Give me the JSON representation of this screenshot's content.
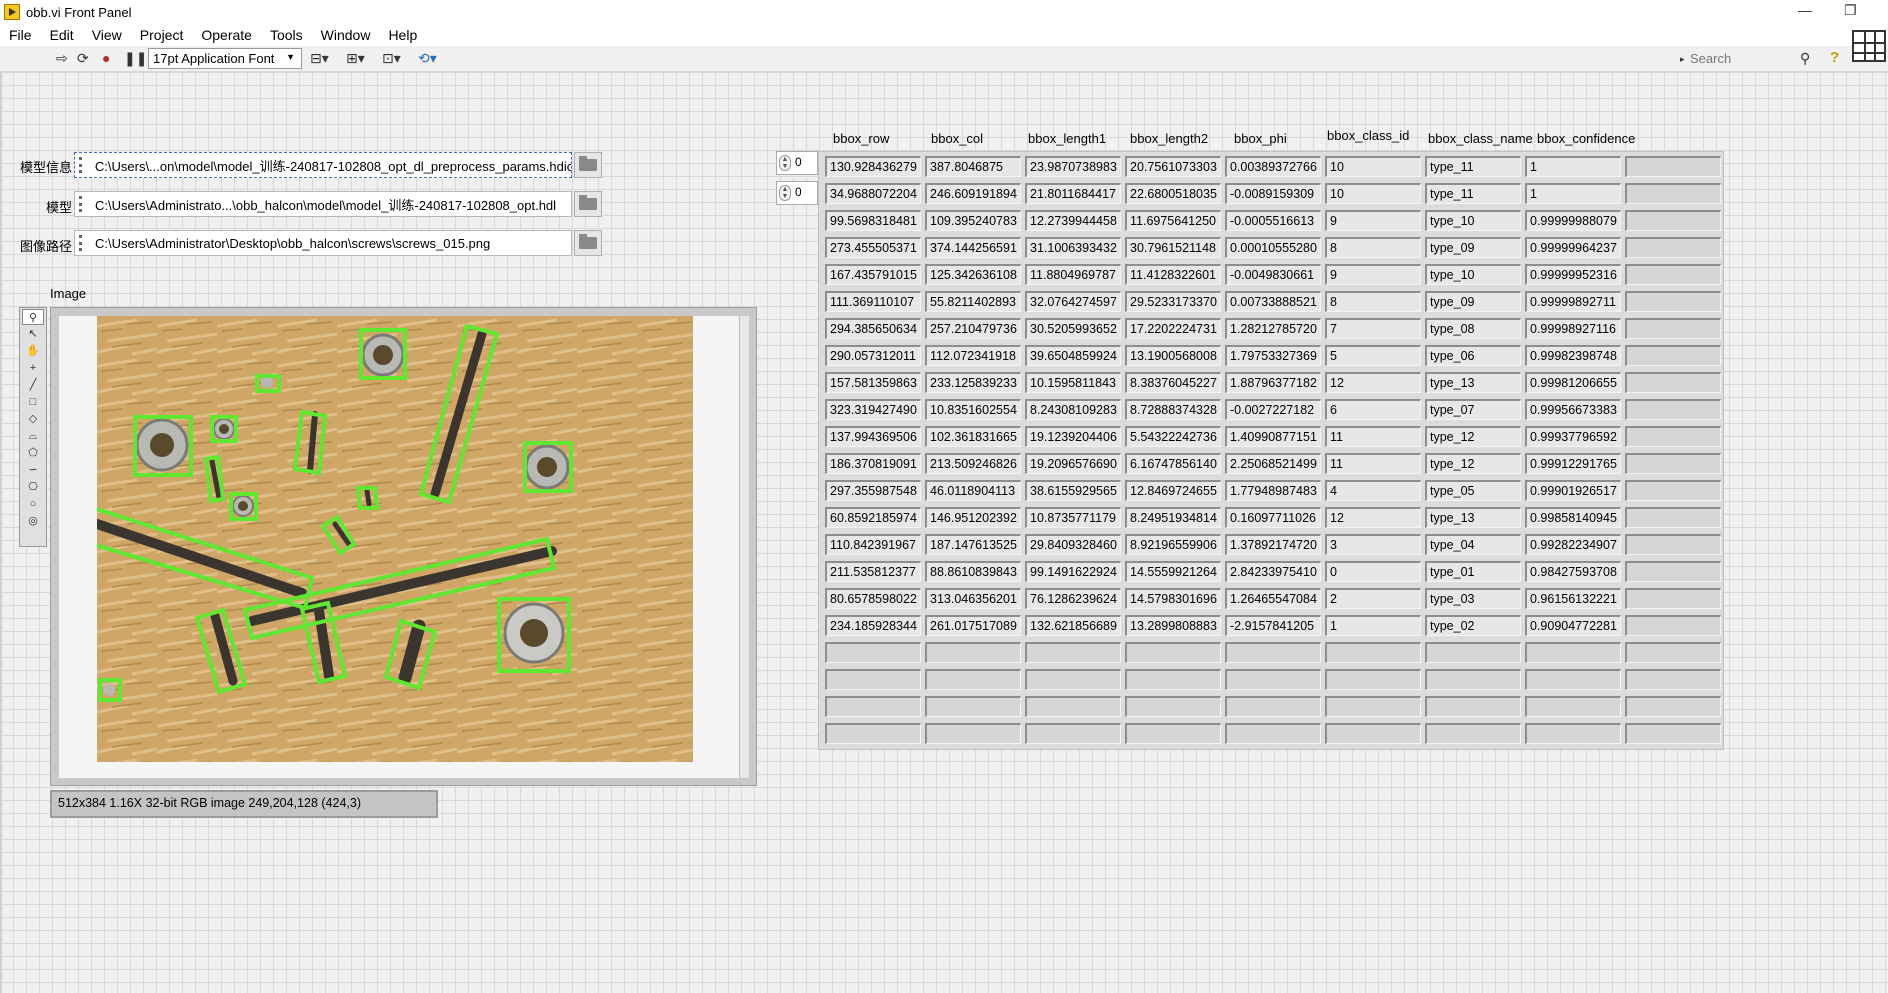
{
  "window": {
    "title": "obb.vi Front Panel"
  },
  "menu": [
    "File",
    "Edit",
    "View",
    "Project",
    "Operate",
    "Tools",
    "Window",
    "Help"
  ],
  "toolbar": {
    "font": "17pt Application Font",
    "search_placeholder": "Search"
  },
  "paths": [
    {
      "label": "模型信息",
      "value": "C:\\Users\\...on\\model\\model_训练-240817-102808_opt_dl_preprocess_params.hdict"
    },
    {
      "label": "模型",
      "value": "C:\\Users\\Administrato...\\obb_halcon\\model\\model_训练-240817-102808_opt.hdl"
    },
    {
      "label": "图像路径",
      "value": "C:\\Users\\Administrator\\Desktop\\obb_halcon\\screws\\screws_015.png"
    }
  ],
  "image_display": {
    "label": "Image",
    "info": "512x384 1.16X 32-bit RGB image 249,204,128     (424,3)"
  },
  "table": {
    "headers": [
      "bbox_row",
      "bbox_col",
      "bbox_length1",
      "bbox_length2",
      "bbox_phi",
      "bbox_class_id",
      "bbox_class_name",
      "bbox_confidence"
    ],
    "row_index": "0",
    "col_index": "0",
    "rows": [
      [
        "130.928436279",
        "387.8046875",
        "23.9870738983",
        "20.7561073303",
        "0.00389372766",
        "10",
        "type_11",
        "1"
      ],
      [
        "34.9688072204",
        "246.609191894",
        "21.8011684417",
        "22.6800518035",
        "-0.0089159309",
        "10",
        "type_11",
        "1"
      ],
      [
        "99.5698318481",
        "109.395240783",
        "12.2739944458",
        "11.6975641250",
        "-0.0005516613",
        "9",
        "type_10",
        "0.99999988079"
      ],
      [
        "273.455505371",
        "374.144256591",
        "31.1006393432",
        "30.7961521148",
        "0.00010555280",
        "8",
        "type_09",
        "0.99999964237"
      ],
      [
        "167.435791015",
        "125.342636108",
        "11.8804969787",
        "11.4128322601",
        "-0.0049830661",
        "9",
        "type_10",
        "0.99999952316"
      ],
      [
        "111.369110107",
        "55.8211402893",
        "32.0764274597",
        "29.5233173370",
        "0.00733888521",
        "8",
        "type_09",
        "0.99999892711"
      ],
      [
        "294.385650634",
        "257.210479736",
        "30.5205993652",
        "17.2202224731",
        "1.28212785720",
        "7",
        "type_08",
        "0.99998927116"
      ],
      [
        "290.057312011",
        "112.072341918",
        "39.6504859924",
        "13.1900568008",
        "1.79753327369",
        "5",
        "type_06",
        "0.99982398748"
      ],
      [
        "157.581359863",
        "233.125839233",
        "10.1595811843",
        "8.38376045227",
        "1.88796377182",
        "12",
        "type_13",
        "0.99981206655"
      ],
      [
        "323.319427490",
        "10.8351602554",
        "8.24308109283",
        "8.72888374328",
        "-0.0027227182",
        "6",
        "type_07",
        "0.99956673383"
      ],
      [
        "137.994369506",
        "102.361831665",
        "19.1239204406",
        "5.54322242736",
        "1.40990877151",
        "11",
        "type_12",
        "0.99937796592"
      ],
      [
        "186.370819091",
        "213.509246826",
        "19.2096576690",
        "6.16747856140",
        "2.25068521499",
        "11",
        "type_12",
        "0.99912291765"
      ],
      [
        "297.355987548",
        "46.0118904113",
        "38.6155929565",
        "12.8469724655",
        "1.77948987483",
        "4",
        "type_05",
        "0.99901926517"
      ],
      [
        "60.8592185974",
        "146.951202392",
        "10.8735771179",
        "8.24951934814",
        "0.16097711026",
        "12",
        "type_13",
        "0.99858140945"
      ],
      [
        "110.842391967",
        "187.147613525",
        "29.8409328460",
        "8.92196559906",
        "1.37892174720",
        "3",
        "type_04",
        "0.99282234907"
      ],
      [
        "211.535812377",
        "88.8610839843",
        "99.1491622924",
        "14.5559921264",
        "2.84233975410",
        "0",
        "type_01",
        "0.98427593708"
      ],
      [
        "80.6578598022",
        "313.046356201",
        "76.1286239624",
        "14.5798301696",
        "1.26465547084",
        "2",
        "type_03",
        "0.96156132221"
      ],
      [
        "234.185928344",
        "261.017517089",
        "132.621856689",
        "13.2899808883",
        "-2.9157841205",
        "1",
        "type_02",
        "0.90904772281"
      ]
    ],
    "empty_rows": 4
  }
}
